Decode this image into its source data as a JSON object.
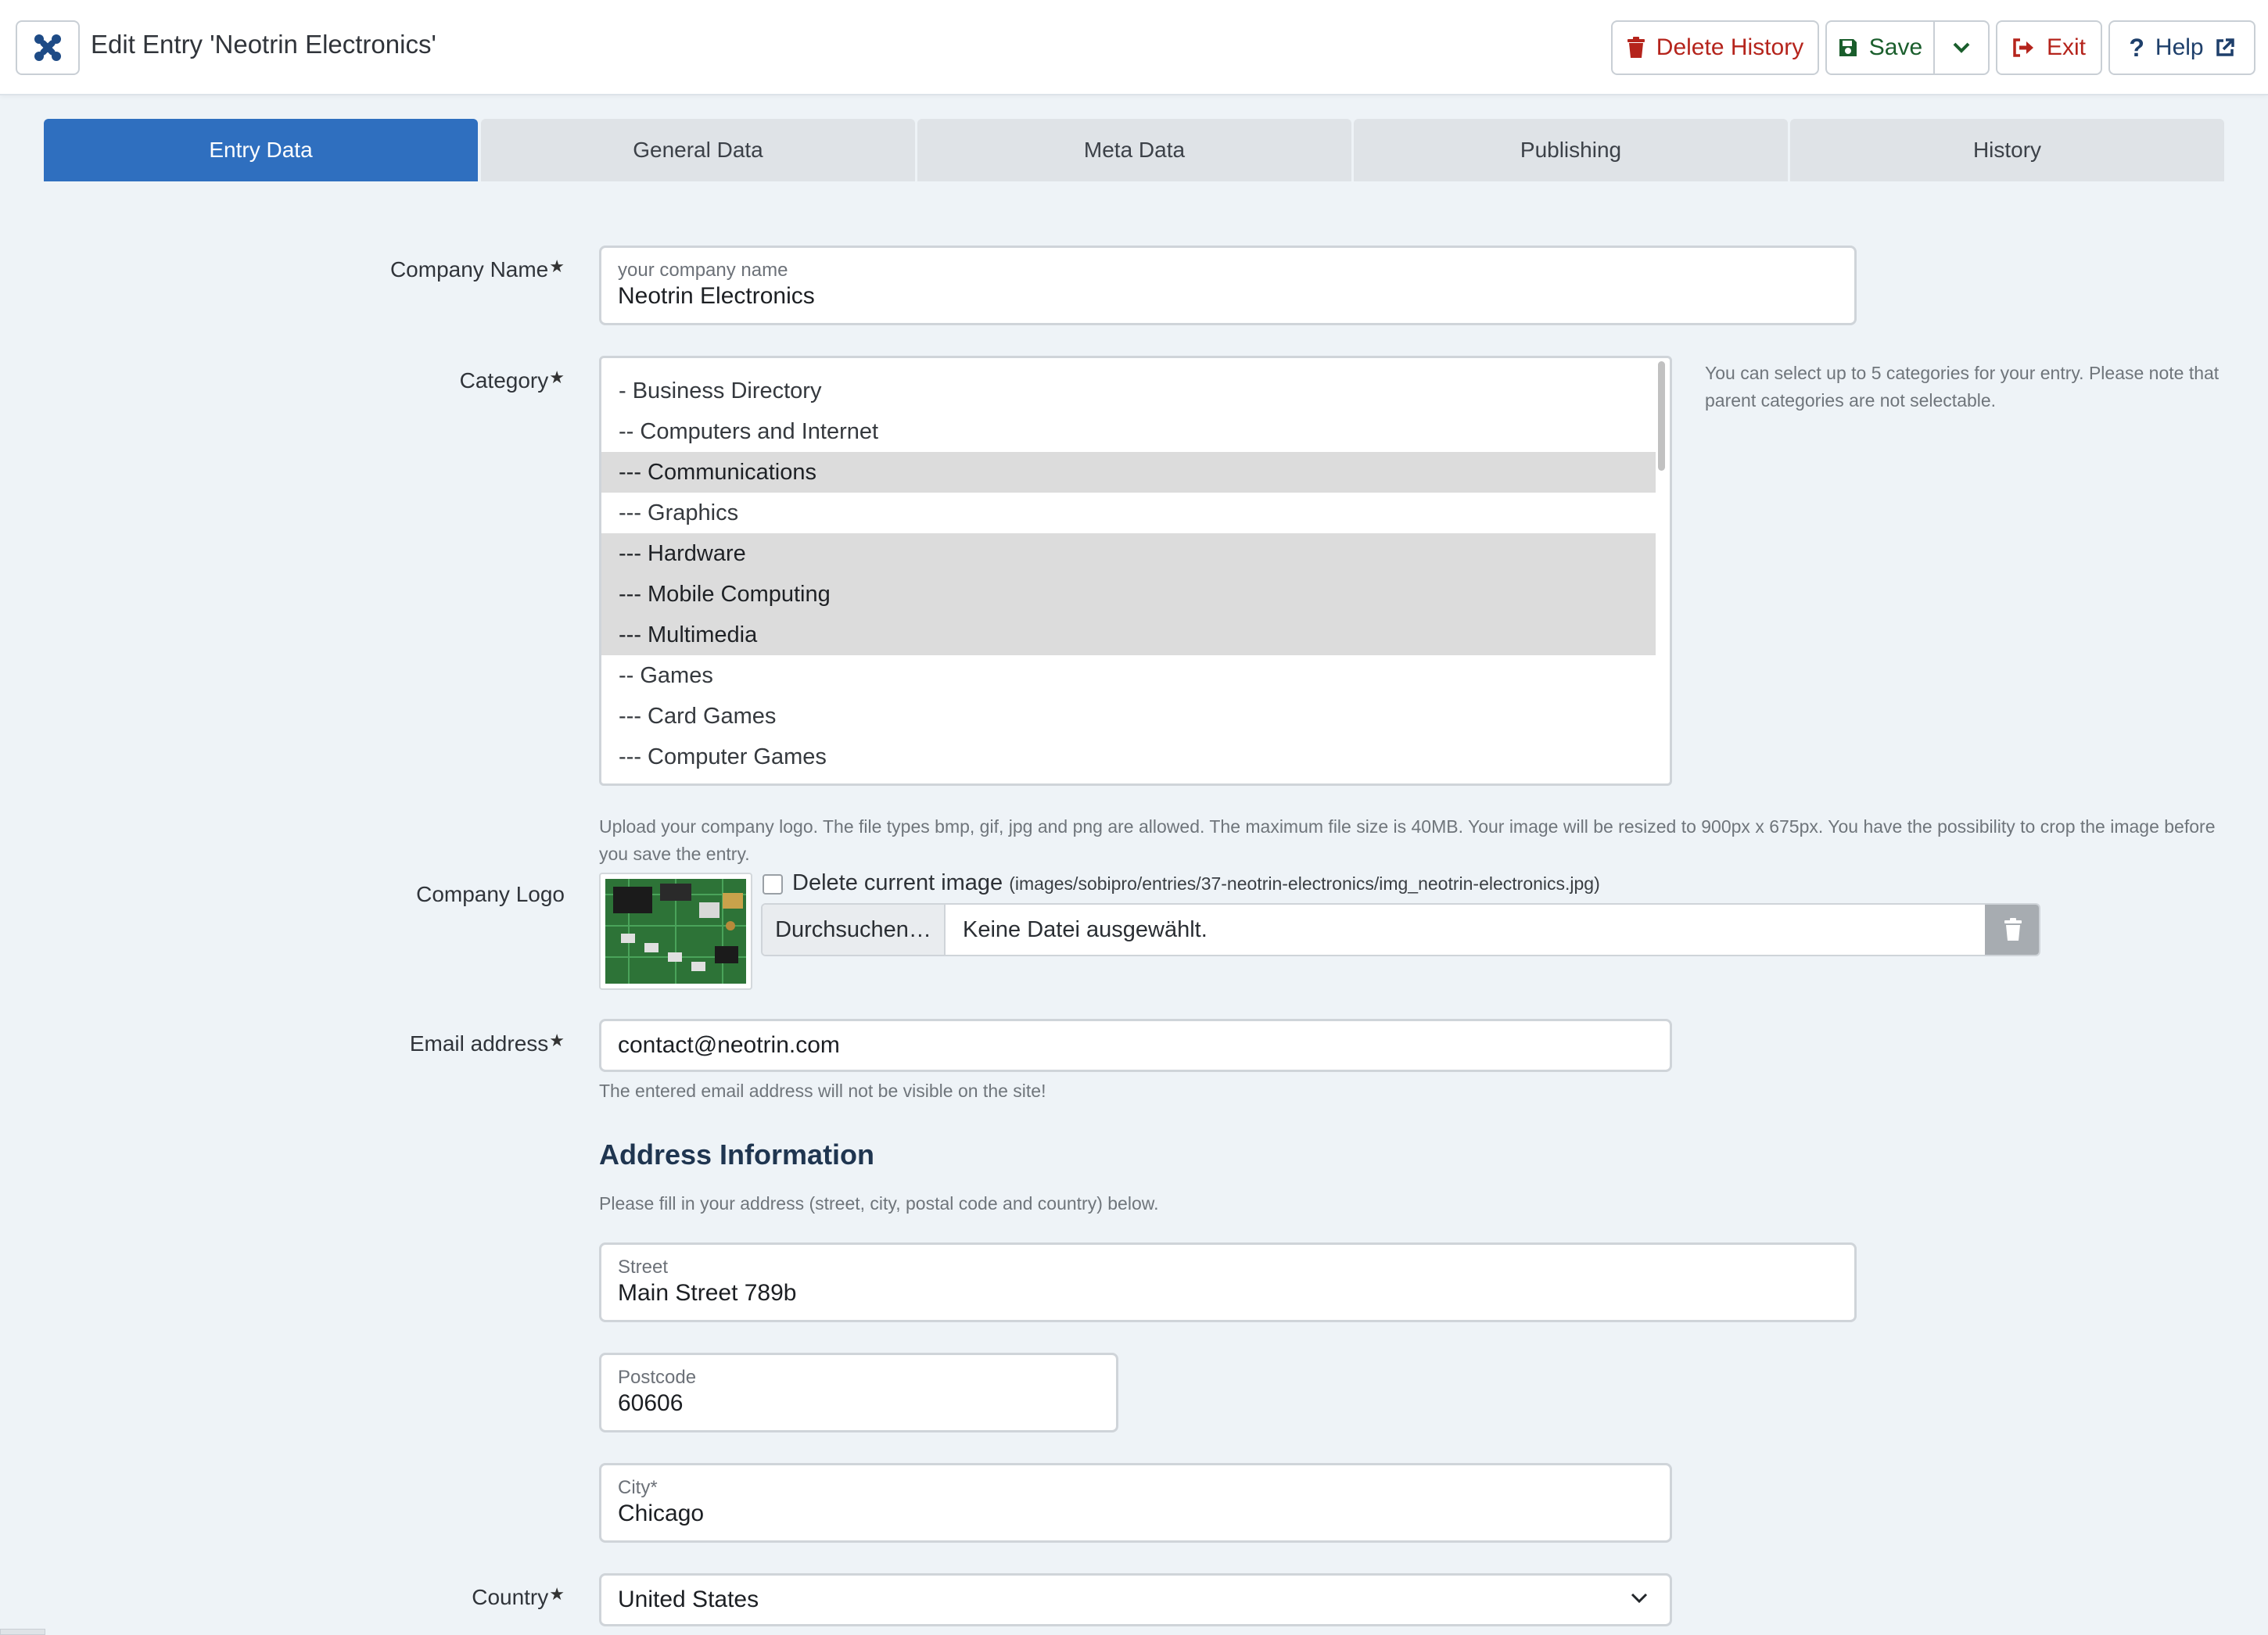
{
  "header": {
    "title": "Edit Entry 'Neotrin Electronics'",
    "buttons": {
      "delete_history": "Delete History",
      "save": "Save",
      "exit": "Exit",
      "help": "Help"
    }
  },
  "tabs": [
    "Entry Data",
    "General Data",
    "Meta Data",
    "Publishing",
    "History"
  ],
  "active_tab": "Entry Data",
  "form": {
    "company_name": {
      "label": "Company Name",
      "placeholder": "your company name",
      "value": "Neotrin Electronics"
    },
    "category": {
      "label": "Category",
      "help": "You can select up to 5 categories for your entry. Please note that parent categories are not selectable.",
      "items": [
        {
          "text": "- Business Directory",
          "selected": false
        },
        {
          "text": "-- Computers and Internet",
          "selected": false
        },
        {
          "text": "--- Communications",
          "selected": true
        },
        {
          "text": "--- Graphics",
          "selected": false
        },
        {
          "text": "--- Hardware",
          "selected": true
        },
        {
          "text": "--- Mobile Computing",
          "selected": true
        },
        {
          "text": "--- Multimedia",
          "selected": true
        },
        {
          "text": "-- Games",
          "selected": false
        },
        {
          "text": "--- Card Games",
          "selected": false
        },
        {
          "text": "--- Computer Games",
          "selected": false
        }
      ]
    },
    "company_logo": {
      "label": "Company Logo",
      "help": "Upload your company logo. The file types bmp, gif, jpg and png are allowed. The maximum file size is 40MB. Your image will be resized to 900px x 675px. You have the possibility to crop the image before you save the entry.",
      "delete_label": "Delete current image",
      "current_path": "(images/sobipro/entries/37-neotrin-electronics/img_neotrin-electronics.jpg)",
      "browse_label": "Durchsuchen…",
      "no_file": "Keine Datei ausgewählt."
    },
    "email": {
      "label": "Email address",
      "value": "contact@neotrin.com",
      "help": "The entered email address will not be visible on the site!"
    },
    "address": {
      "title": "Address Information",
      "help": "Please fill in your address (street, city, postal code and country) below.",
      "street": {
        "label": "Street",
        "value": "Main Street 789b"
      },
      "postcode": {
        "label": "Postcode",
        "value": "60606"
      },
      "city": {
        "label": "City*",
        "value": "Chicago"
      }
    },
    "country": {
      "label": "Country",
      "value": "United States"
    }
  },
  "colors": {
    "primary": "#2f6fbf",
    "danger": "#b5241c",
    "success": "#1a5e2c",
    "background": "#eef3f7"
  }
}
